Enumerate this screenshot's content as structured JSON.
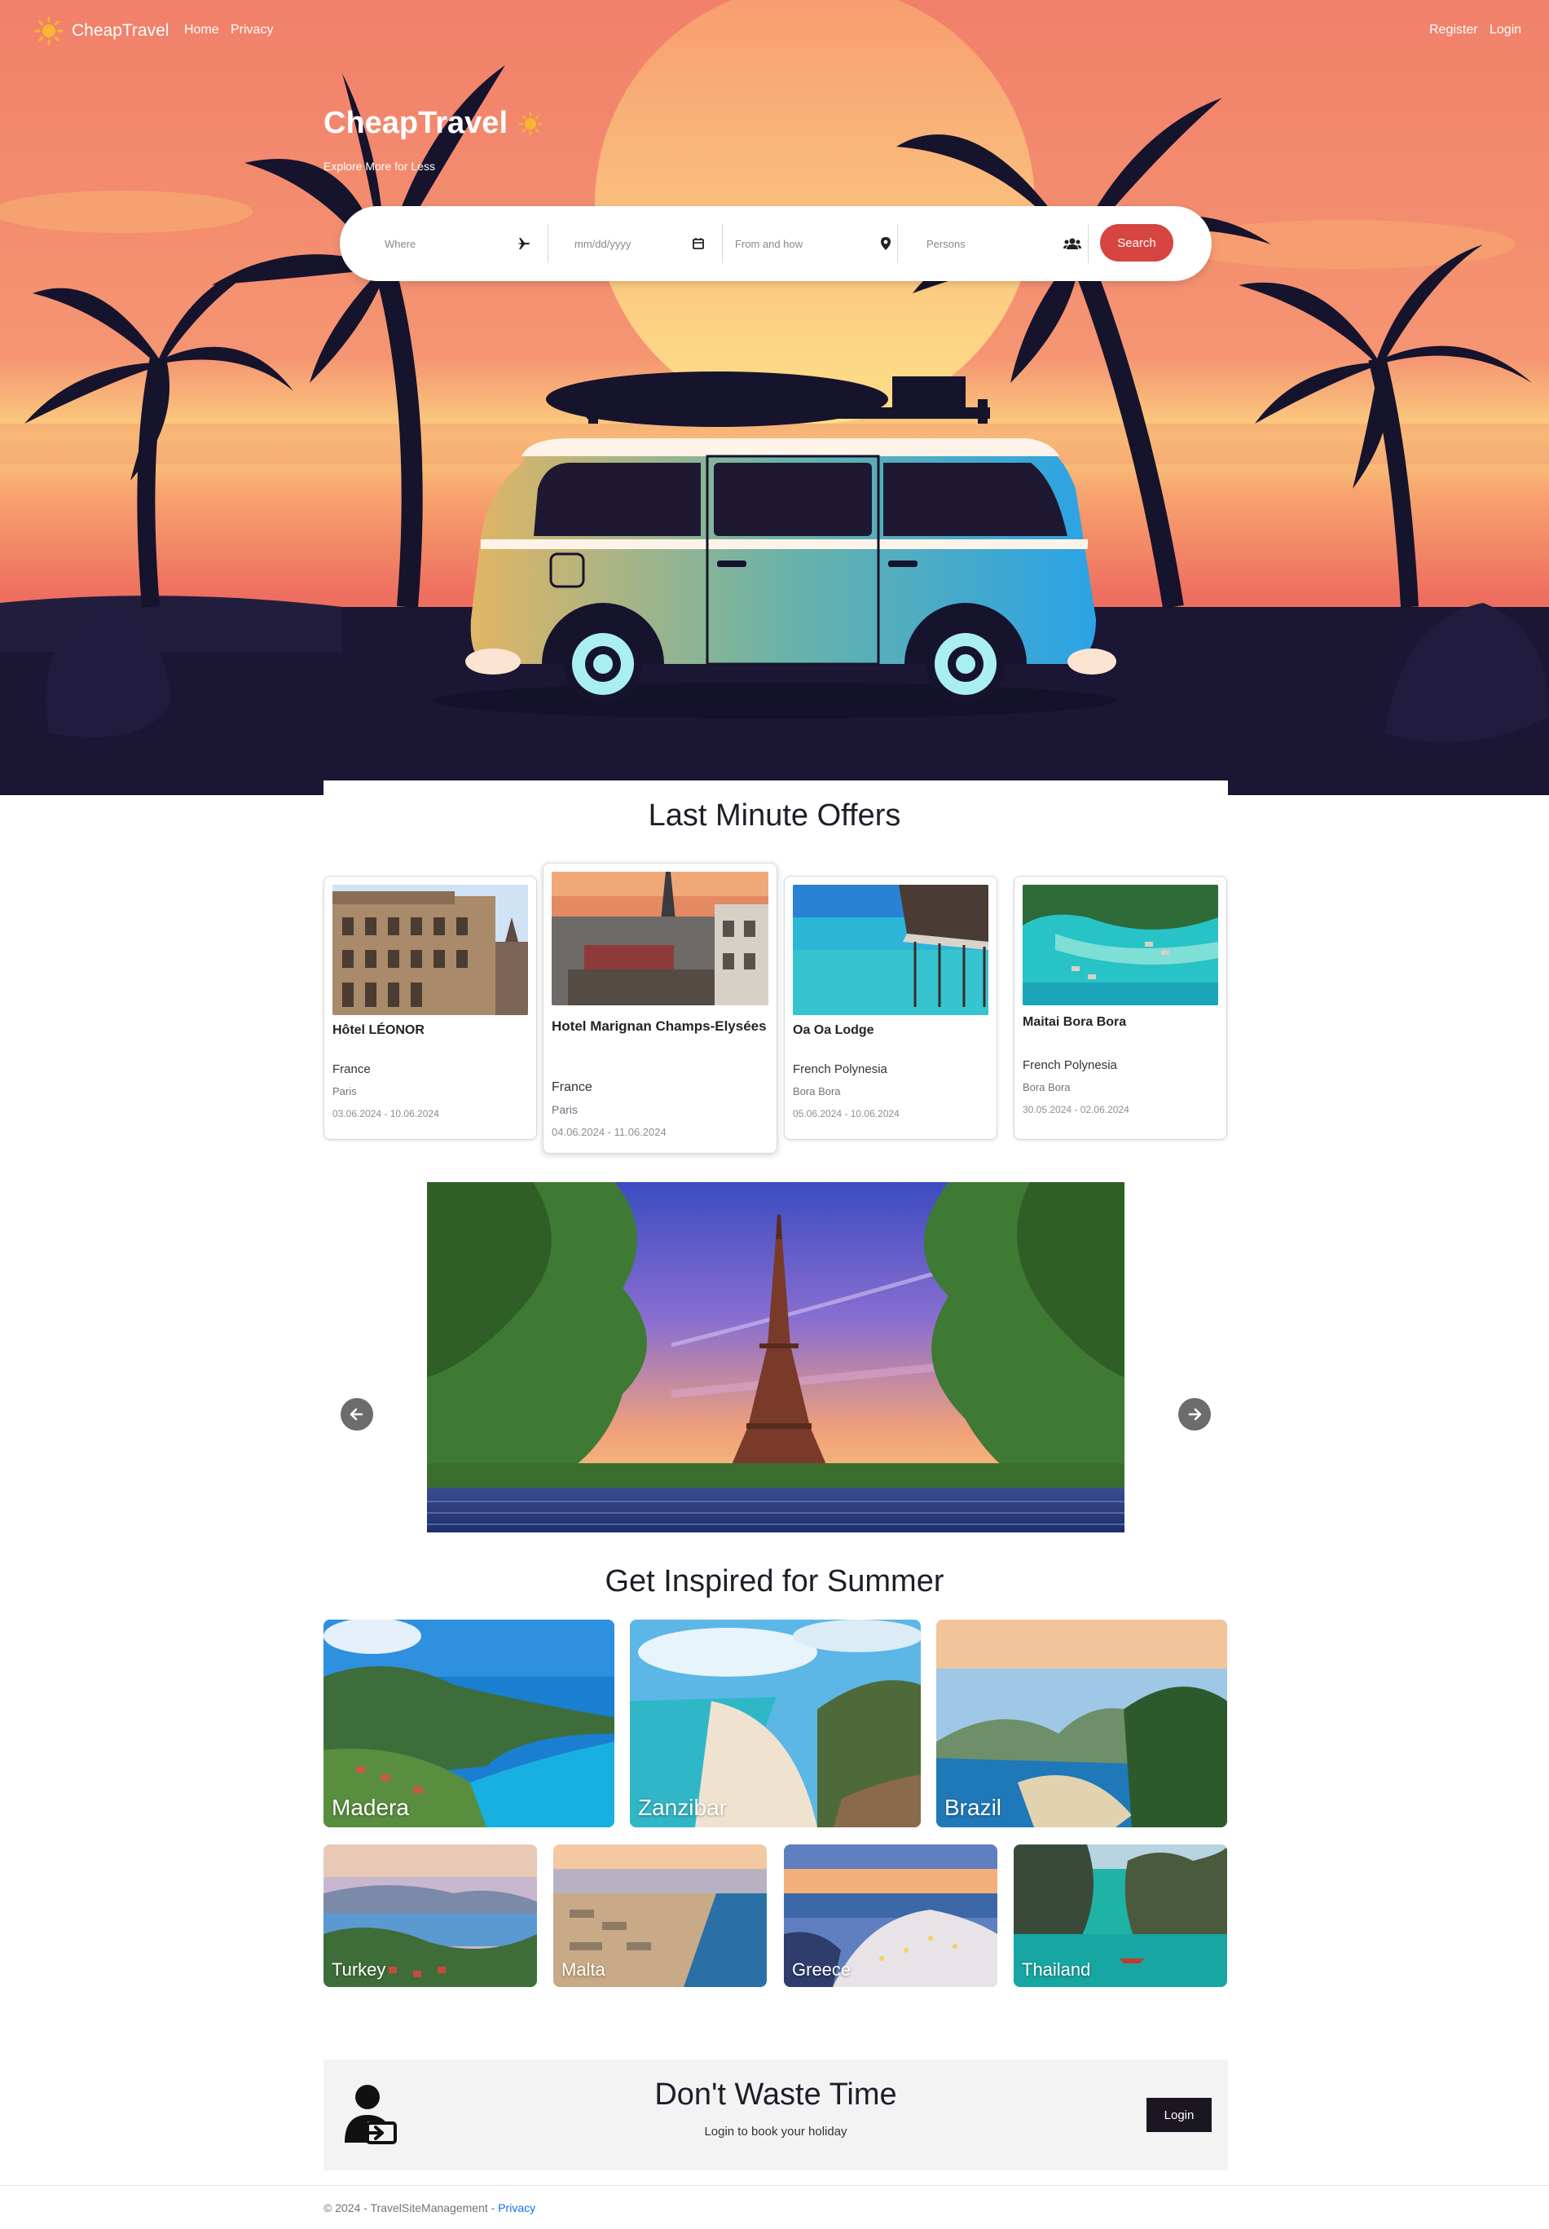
{
  "nav": {
    "brand": "CheapTravel",
    "links": [
      "Home",
      "Privacy"
    ],
    "register": "Register",
    "login": "Login"
  },
  "hero": {
    "title": "CheapTravel",
    "subtitle": "Explore More for Less"
  },
  "search": {
    "where_placeholder": "Where",
    "date_placeholder": "mm/dd/yyyy",
    "from_placeholder": "From and how",
    "persons_placeholder": "Persons",
    "button": "Search"
  },
  "offers": {
    "title": "Last Minute Offers",
    "items": [
      {
        "name": "Hôtel LÉONOR",
        "country": "France",
        "city": "Paris",
        "dates": "03.06.2024 - 10.06.2024"
      },
      {
        "name": "Hotel Marignan Champs-Elysées",
        "country": "France",
        "city": "Paris",
        "dates": "04.06.2024 - 11.06.2024"
      },
      {
        "name": "Oa Oa Lodge",
        "country": "French Polynesia",
        "city": "Bora Bora",
        "dates": "05.06.2024 - 10.06.2024"
      },
      {
        "name": "Maitai Bora Bora",
        "country": "French Polynesia",
        "city": "Bora Bora",
        "dates": "30.05.2024 - 02.06.2024"
      }
    ]
  },
  "inspiration": {
    "title": "Get Inspired for Summer",
    "destinations": [
      "Madera",
      "Zanzibar",
      "Brazil",
      "Turkey",
      "Malta",
      "Greece",
      "Thailand"
    ]
  },
  "cta": {
    "title": "Don't Waste Time",
    "subtitle": "Login to book your holiday",
    "button": "Login"
  },
  "footer": {
    "text": "© 2024 - TravelSiteManagement - ",
    "link": "Privacy"
  },
  "colors": {
    "accent": "#d64541",
    "dark": "#1b1722",
    "sunset": "#f4866c"
  }
}
